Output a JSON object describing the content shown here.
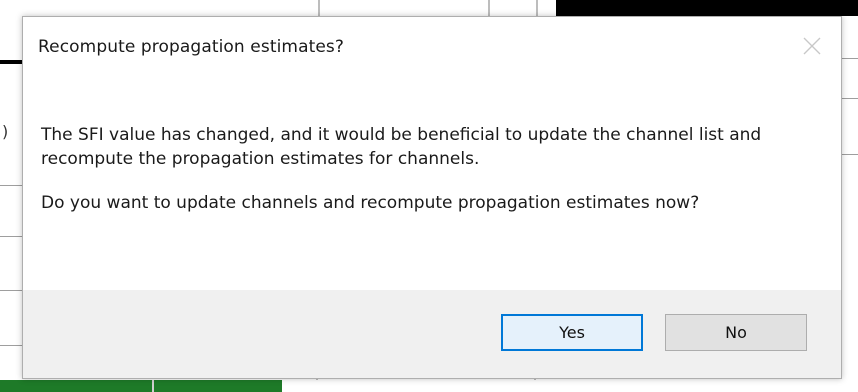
{
  "dialog": {
    "title": "Recompute propagation estimates?",
    "message_paragraphs": [
      "The SFI value has changed, and it would be beneficial to update the channel list and recompute the propagation estimates for channels.",
      "Do you want to update channels and recompute propagation estimates now?"
    ],
    "buttons": {
      "yes_label": "Yes",
      "no_label": "No"
    },
    "close_icon": "close-icon"
  },
  "background": {
    "partial_text": ")"
  },
  "colors": {
    "accent_border": "#0078d7",
    "footer_bg": "#f0f0f0",
    "default_button_bg": "#e5f1fb"
  }
}
